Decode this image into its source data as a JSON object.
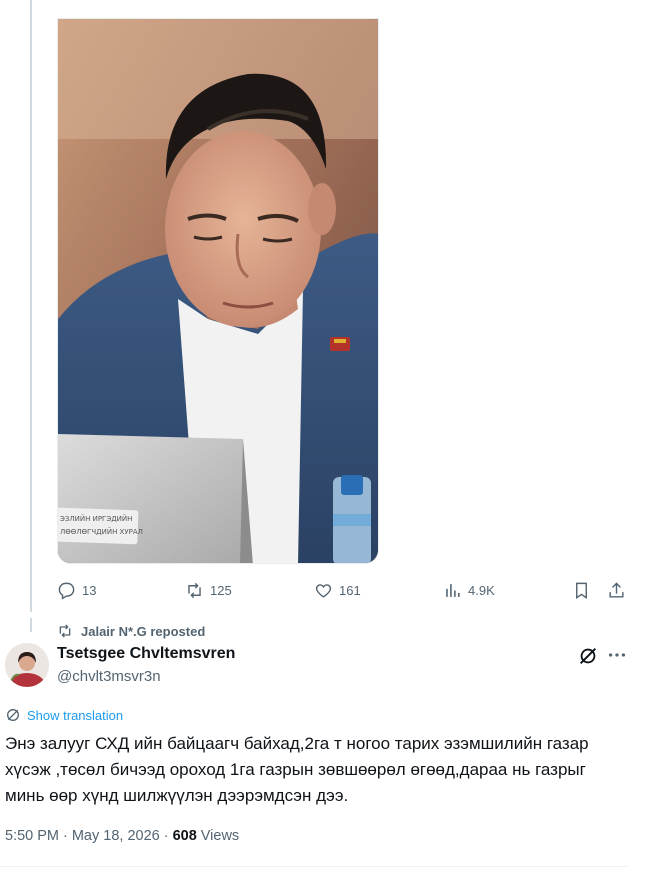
{
  "post": {
    "actions": {
      "replies": "13",
      "reposts": "125",
      "likes": "161",
      "views": "4.9K"
    }
  },
  "repost_banner": {
    "text": "Jalair N*.G reposted"
  },
  "tweet": {
    "author_name": "Tsetsgee Chvltemsvren",
    "author_handle": "@chvlt3msvr3n",
    "translate_label": "Show translation",
    "text": "Энэ залууг СХД ийн байцаагч байхад,2га т ногоо тарих эзэмшилийн газар хүсэж ,төсөл бичээд ороход 1га газрын зөвшөөрөл өгөөд,дараа нь газрыг минь өөр хүнд шилжүүлэн дээрэмдсэн дээ.",
    "time": "5:50 PM",
    "date": "May 18, 2026",
    "separator": "·",
    "views_count": "608",
    "views_label": "Views"
  },
  "photo": {
    "sign_line1": "ЭЗЛИЙН ИРГЭДИЙН",
    "sign_line2": "ЛӨӨЛӨГЧДИЙН ХУРАЛ"
  },
  "colors": {
    "text_primary": "#0f1419",
    "text_secondary": "#536471",
    "link_blue": "#1d9bf0",
    "thread_line": "#cfd9de"
  },
  "icons": [
    "reply-icon",
    "repost-icon",
    "like-icon",
    "views-icon",
    "bookmark-icon",
    "share-icon",
    "grok-icon",
    "more-icon",
    "translate-icon"
  ]
}
